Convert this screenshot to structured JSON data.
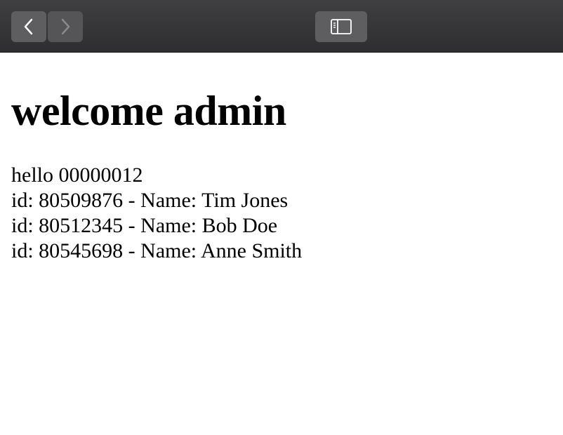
{
  "toolbar": {
    "back_icon": "chevron-left-icon",
    "forward_icon": "chevron-right-icon",
    "sidebar_icon": "sidebar-icon"
  },
  "page": {
    "title": "welcome admin",
    "greeting": "hello 00000012",
    "users": [
      "id: 80509876 - Name: Tim Jones",
      "id: 80512345 - Name: Bob Doe",
      "id: 80545698 - Name: Anne Smith"
    ]
  },
  "colors": {
    "toolbar_bg": "#333336",
    "button_bg": "#5e5e61",
    "text": "#000000",
    "page_bg": "#ffffff"
  }
}
